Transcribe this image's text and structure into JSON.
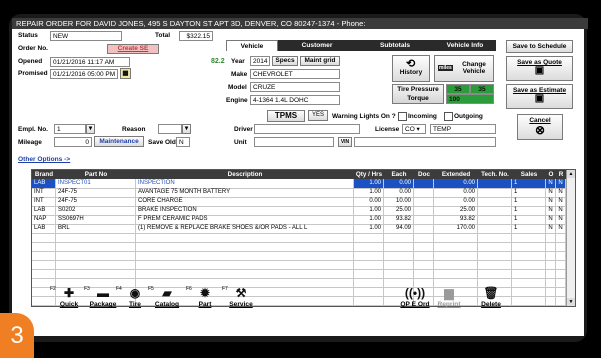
{
  "window": {
    "title": "REPAIR ORDER FOR DAVID JONES, 495 S DAYTON ST APT 3D, DENVER,  CO  80247-1374 - Phone:"
  },
  "header": {
    "status_label": "Status",
    "status": "NEW",
    "total_label": "Total",
    "total": "$322.15",
    "order_no_label": "Order No.",
    "create_se": "Create SE",
    "opened_label": "Opened",
    "opened": "01/21/2016 11:17 AM",
    "promised_label": "Promised",
    "promised": "01/21/2016 05:00 PM"
  },
  "tabs": [
    "Vehicle",
    "Customer",
    "Subtotals",
    "Vehicle Info"
  ],
  "vehicle": {
    "mileage_badge": "82.2",
    "year_label": "Year",
    "year": "2014",
    "specs": "Specs",
    "maint_grid": "Maint grid",
    "make_label": "Make",
    "make": "CHEVROLET",
    "model_label": "Model",
    "model": "CRUZE",
    "engine_label": "Engine",
    "engine": "4-1364 1.4L DOHC",
    "history": "History",
    "miles_label": "miles",
    "change_vehicle": "Change Vehicle",
    "tire_pressure": "Tire Pressure",
    "torque": "Torque",
    "tp_front": "35",
    "tp_rear": "35",
    "torque_value": "100"
  },
  "tpms": {
    "label": "TPMS",
    "yes": "YES",
    "warning": "Warning Lights On ?",
    "incoming": "Incoming",
    "outgoing": "Outgoing"
  },
  "people": {
    "driver_label": "Driver",
    "unit_label": "Unit",
    "vin_label": "VIN",
    "license_label": "License",
    "state": "CO",
    "license": "TEMP"
  },
  "left": {
    "empl_label": "Empl. No.",
    "empl": "1",
    "reason_label": "Reason",
    "mileage_label": "Mileage",
    "mileage": "0",
    "maintenance": "Maintenance",
    "save_old_label": "Save Old",
    "save_old": "N",
    "other_options": "Other Options ->"
  },
  "actions": {
    "save_schedule": "Save to Schedule",
    "save_quote": "Save as Quote",
    "save_estimate": "Save as Estimate",
    "cancel": "Cancel"
  },
  "grid": {
    "headers": [
      "Brand",
      "Part No",
      "Description",
      "Qty / Hrs",
      "Each",
      "Doc",
      "Extended",
      "Tech. No.",
      "Sales",
      "O",
      "R"
    ],
    "rows": [
      [
        "LAB",
        "INSPECT01",
        "INSPECTION",
        "1.00",
        "0.00",
        "",
        "0.00",
        "",
        "1",
        "N",
        "N"
      ],
      [
        "INT",
        "24F-75",
        "AVANTAGE 75 MONTH BATTERY",
        "1.00",
        "0.00",
        "",
        "0.00",
        "",
        "1",
        "N",
        "N"
      ],
      [
        "INT",
        "24F-75",
        "CORE CHARGE",
        "0.00",
        "10.00",
        "",
        "0.00",
        "",
        "1",
        "N",
        "N"
      ],
      [
        "LAB",
        "S0202",
        "BRAKE INSPECTION",
        "1.00",
        "25.00",
        "",
        "25.00",
        "",
        "1",
        "N",
        "N"
      ],
      [
        "NAP",
        "SS0697H",
        "F PREM CERAMIC PADS",
        "1.00",
        "93.82",
        "",
        "93.82",
        "",
        "1",
        "N",
        "N"
      ],
      [
        "LAB",
        "BRL",
        "(1) REMOVE & REPLACE BRAKE SHOES &/OR PADS - ALL L",
        "1.00",
        "94.09",
        "",
        "170.00",
        "",
        "1",
        "N",
        "N"
      ],
      [
        "",
        "",
        "",
        "",
        "",
        "",
        "",
        "",
        "",
        "",
        ""
      ],
      [
        "",
        "",
        "",
        "",
        "",
        "",
        "",
        "",
        "",
        "",
        ""
      ],
      [
        "",
        "",
        "",
        "",
        "",
        "",
        "",
        "",
        "",
        "",
        ""
      ],
      [
        "",
        "",
        "",
        "",
        "",
        "",
        "",
        "",
        "",
        "",
        ""
      ],
      [
        "",
        "",
        "",
        "",
        "",
        "",
        "",
        "",
        "",
        "",
        ""
      ],
      [
        "",
        "",
        "",
        "",
        "",
        "",
        "",
        "",
        "",
        "",
        ""
      ],
      [
        "",
        "",
        "",
        "",
        "",
        "",
        "",
        "",
        "",
        "",
        ""
      ],
      [
        "",
        "",
        "",
        "",
        "",
        "",
        "",
        "",
        "",
        "",
        ""
      ]
    ]
  },
  "toolbar": [
    {
      "key": "F2",
      "label": "Quick",
      "icon": "plus-icon",
      "glyph": "✚"
    },
    {
      "key": "F3",
      "label": "Package",
      "icon": "package-icon",
      "glyph": "▬"
    },
    {
      "key": "F4",
      "label": "Tire",
      "icon": "tire-icon",
      "glyph": "◉"
    },
    {
      "key": "F5",
      "label": "Catalog",
      "icon": "catalog-icon",
      "glyph": "▰"
    },
    {
      "key": "F6",
      "label": "Part",
      "icon": "gear-icon",
      "glyph": "✹"
    },
    {
      "key": "F7",
      "label": "Service",
      "icon": "wrench-icon",
      "glyph": "⚒"
    },
    {
      "key": "",
      "label": "QP E Ord",
      "icon": "signal-icon",
      "glyph": "((•))"
    },
    {
      "key": "",
      "label": "Reprint",
      "icon": "printer-icon",
      "glyph": "▆"
    },
    {
      "key": "",
      "label": "Delete",
      "icon": "trash-icon",
      "glyph": "🗑"
    }
  ],
  "step_badge": "3",
  "colors": {
    "titlebar": "#3b3b3b",
    "selected_row": "#1c51c3",
    "badge": "#f07f23",
    "link": "#1f3fa8",
    "create_se": "#c23b3b"
  }
}
